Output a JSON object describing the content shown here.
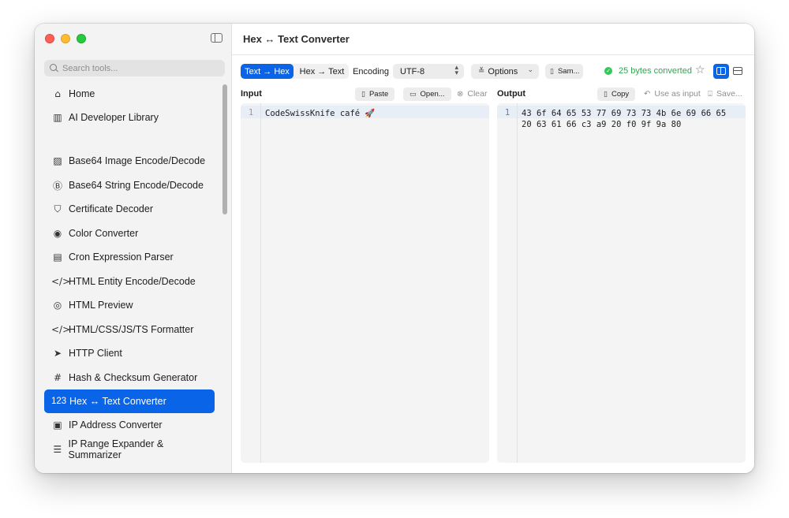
{
  "window": {
    "title": "Hex ↔ Text Converter"
  },
  "sidebar": {
    "search_placeholder": "Search tools...",
    "items": [
      {
        "label": "Home",
        "icon": "⌂",
        "icon_name": "home-icon"
      },
      {
        "label": "AI Developer Library",
        "icon": "▥",
        "icon_name": "library-icon"
      },
      {
        "label": "Base64 Image Encode/Decode",
        "icon": "▨",
        "icon_name": "image-icon"
      },
      {
        "label": "Base64 String Encode/Decode",
        "icon": "Ⓑ",
        "icon_name": "b-square-icon"
      },
      {
        "label": "Certificate Decoder",
        "icon": "⛉",
        "icon_name": "shield-icon"
      },
      {
        "label": "Color Converter",
        "icon": "◉",
        "icon_name": "palette-icon"
      },
      {
        "label": "Cron Expression Parser",
        "icon": "▤",
        "icon_name": "calendar-clock-icon"
      },
      {
        "label": "HTML Entity Encode/Decode",
        "icon": "</>",
        "icon_name": "code-icon"
      },
      {
        "label": "HTML Preview",
        "icon": "◎",
        "icon_name": "eye-icon"
      },
      {
        "label": "HTML/CSS/JS/TS Formatter",
        "icon": "</>",
        "icon_name": "code-icon"
      },
      {
        "label": "HTTP Client",
        "icon": "➤",
        "icon_name": "paper-plane-icon"
      },
      {
        "label": "Hash & Checksum Generator",
        "icon": "#",
        "icon_name": "hash-icon"
      },
      {
        "label": "Hex ↔ Text Converter",
        "icon": "123",
        "icon_name": "numbers-icon",
        "active": true
      },
      {
        "label": "IP Address Converter",
        "icon": "▣",
        "icon_name": "ip-icon"
      },
      {
        "label": "IP Range Expander & Summarizer",
        "icon": "☰",
        "icon_name": "list-icon"
      }
    ]
  },
  "toolbar": {
    "mode_text_to_hex": "Text → Hex",
    "mode_hex_to_text": "Hex → Text",
    "encoding_label": "Encoding",
    "encoding_value": "UTF-8",
    "options_label": "Options",
    "sample_label": "Sam...",
    "status_text": "25 bytes converted"
  },
  "input": {
    "label": "Input",
    "paste_label": "Paste",
    "open_label": "Open...",
    "clear_label": "Clear",
    "line_number": "1",
    "value": "CodeSwissKnife café 🚀"
  },
  "output": {
    "label": "Output",
    "copy_label": "Copy",
    "use_as_input_label": "Use as input",
    "save_label": "Save...",
    "line_number": "1",
    "value": "43 6f 64 65 53 77 69 73 73 4b 6e 69 66 65 20 63 61 66 c3 a9 20 f0 9f 9a 80"
  },
  "colors": {
    "accent": "#0a64e8",
    "success": "#34c759",
    "sidebar_bg": "#f3f3f3",
    "editor_bg": "#f4f4f4"
  }
}
